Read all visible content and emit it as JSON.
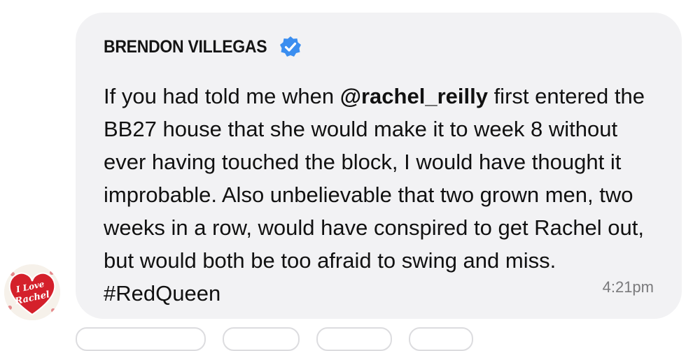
{
  "message": {
    "sender_name": "BRENDON VILLEGAS",
    "verified_icon": "verified-badge-icon",
    "text_before_mention": "If you had told me when ",
    "mention": "@rachel_reilly",
    "text_after_mention": " first entered the BB27 house that she would make it to week 8 without ever having touched the block, I would have thought it improbable. Also unbelievable that two grown men, two weeks in a row, would have conspired to get Rachel out, but would both be too afraid to swing and miss. #RedQueen",
    "timestamp": "4:21pm"
  },
  "avatar": {
    "icon": "i-love-rachel-heart-avatar",
    "lettering": "I Love Rachel"
  },
  "colors": {
    "bubble_background": "#f2f2f4",
    "verified_blue": "#3b8ef0",
    "heart_red": "#d4202b",
    "timestamp_gray": "#7a7a7c"
  }
}
